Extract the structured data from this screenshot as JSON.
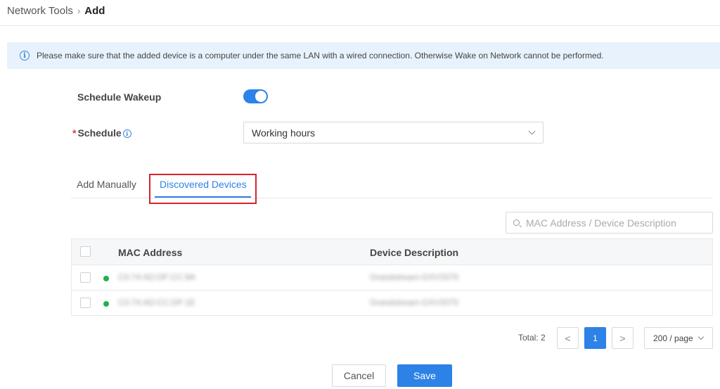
{
  "breadcrumb": {
    "parent": "Network Tools",
    "separator": "›",
    "current": "Add"
  },
  "alert": {
    "icon": "info-icon",
    "text": "Please make sure that the added device is a computer under the same LAN with a wired connection. Otherwise Wake on Network cannot be performed."
  },
  "form": {
    "schedule_wakeup_label": "Schedule Wakeup",
    "schedule_wakeup_enabled": true,
    "schedule_required_mark": "*",
    "schedule_label": "Schedule",
    "schedule_info_glyph": "i",
    "schedule_value": "Working hours"
  },
  "tabs": [
    {
      "label": "Add Manually",
      "active": false
    },
    {
      "label": "Discovered Devices",
      "active": true
    }
  ],
  "search": {
    "placeholder": "MAC Address / Device Description"
  },
  "table": {
    "columns": [
      "MAC Address",
      "Device Description"
    ],
    "rows": [
      {
        "status": "online",
        "mac": "C0:74:AD:DF:CC:9A",
        "description": "Grandstream-GXV3370"
      },
      {
        "status": "online",
        "mac": "C0:74:AD:CC:DF:1E",
        "description": "Grandstream-GXV3370"
      }
    ]
  },
  "pagination": {
    "total_label": "Total: 2",
    "prev": "<",
    "current_page": "1",
    "next": ">",
    "page_size": "200 / page"
  },
  "actions": {
    "cancel": "Cancel",
    "save": "Save"
  },
  "colors": {
    "accent": "#2c82e6",
    "alert_bg": "#e8f2fd",
    "status_online": "#22b14c",
    "highlight": "#d8232a",
    "required": "#e0393e"
  }
}
